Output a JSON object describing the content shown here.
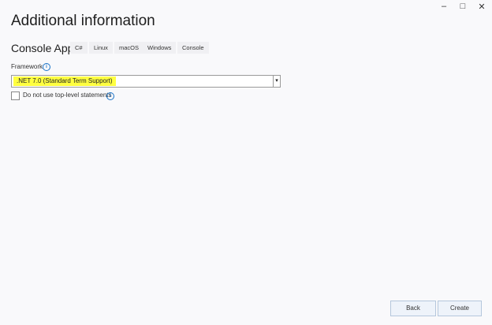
{
  "window": {
    "minimize_icon": "minimize-icon",
    "maximize_icon": "maximize-icon",
    "close_icon": "close-icon"
  },
  "title": "Additional information",
  "project": {
    "name": "Console App",
    "tags": [
      "C#",
      "Linux",
      "macOS",
      "Windows",
      "Console"
    ]
  },
  "framework": {
    "label": "Framework",
    "selected": ".NET 7.0 (Standard Term Support)",
    "highlight_color": "#ffff40"
  },
  "top_level": {
    "label": "Do not use top-level statements",
    "checked": false
  },
  "buttons": {
    "back": "Back",
    "create": "Create"
  }
}
